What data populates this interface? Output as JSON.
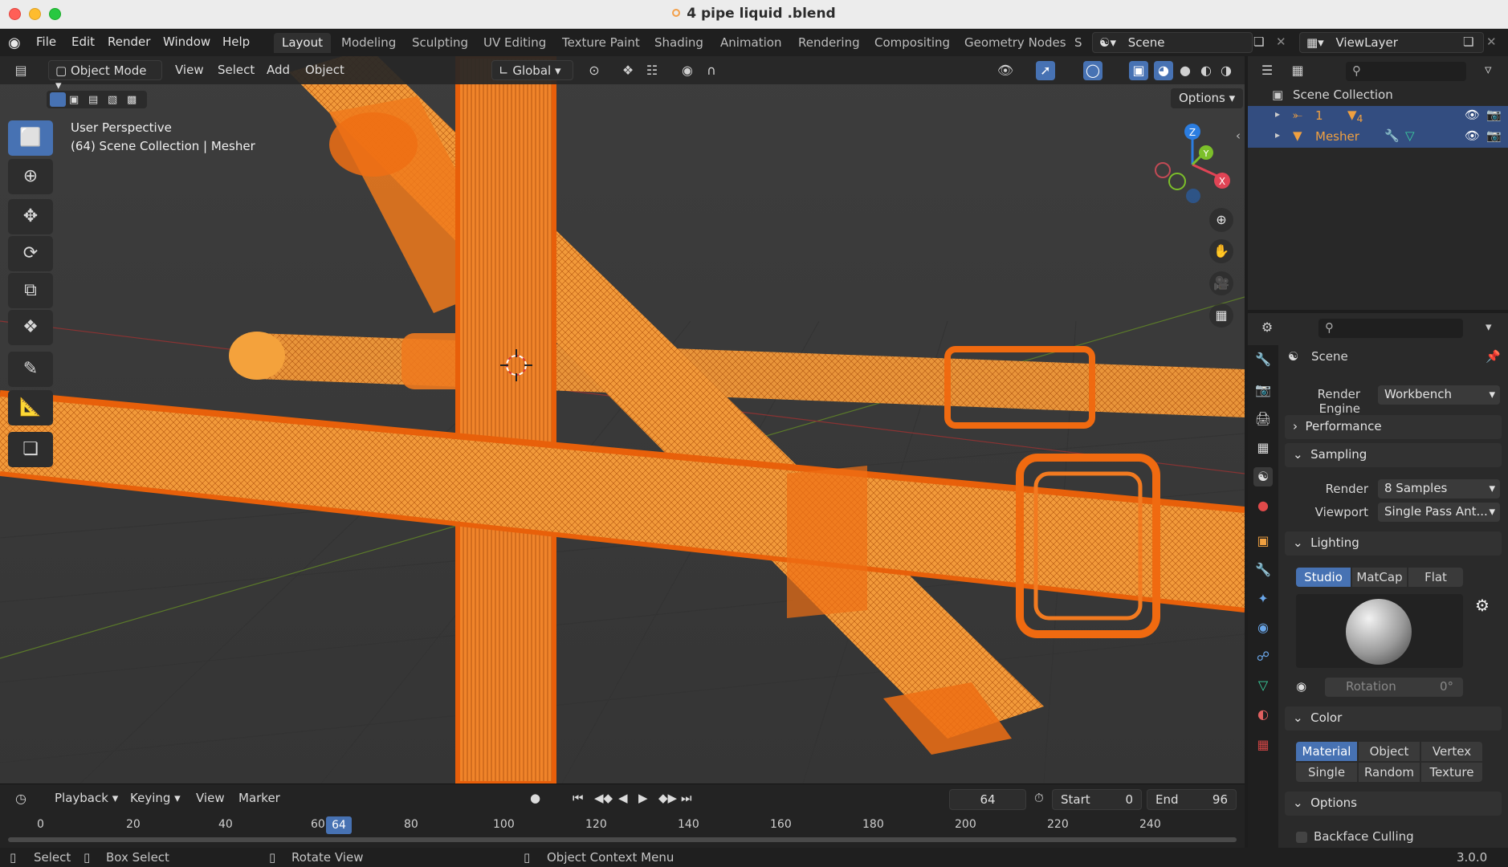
{
  "window": {
    "title": "4 pipe liquid .blend"
  },
  "menu": [
    "File",
    "Edit",
    "Render",
    "Window",
    "Help"
  ],
  "workspaces": [
    "Layout",
    "Modeling",
    "Sculpting",
    "UV Editing",
    "Texture Paint",
    "Shading",
    "Animation",
    "Rendering",
    "Compositing",
    "Geometry Nodes",
    "S"
  ],
  "active_workspace": "Layout",
  "scene_name": "Scene",
  "view_layer": "ViewLayer",
  "viewport": {
    "mode": "Object Mode",
    "menus": [
      "View",
      "Select",
      "Add",
      "Object"
    ],
    "orientation": "Global",
    "options_label": "Options",
    "info_line1": "User Perspective",
    "info_line2": "(64) Scene Collection | Mesher",
    "gizmo": {
      "x": "X",
      "y": "Y",
      "z": "Z"
    }
  },
  "outliner": {
    "root": "Scene Collection",
    "items": [
      {
        "name": "1",
        "badge": "4"
      },
      {
        "name": "Mesher"
      }
    ]
  },
  "properties": {
    "context": "Scene",
    "render_engine_label": "Render Engine",
    "render_engine": "Workbench",
    "performance": "Performance",
    "sampling": "Sampling",
    "render_label": "Render",
    "render_samples": "8 Samples",
    "viewport_label": "Viewport",
    "viewport_aa": "Single Pass Ant...",
    "lighting": "Lighting",
    "lighting_modes": [
      "Studio",
      "MatCap",
      "Flat"
    ],
    "rotation_label": "Rotation",
    "rotation_value": "0°",
    "color": "Color",
    "color_modes": [
      "Material",
      "Object",
      "Vertex",
      "Single",
      "Random",
      "Texture"
    ],
    "options": "Options",
    "backface": "Backface Culling"
  },
  "timeline": {
    "menus": [
      "Playback",
      "Keying",
      "View",
      "Marker"
    ],
    "current_frame": "64",
    "start_label": "Start",
    "start": "0",
    "end_label": "End",
    "end": "96",
    "ruler": [
      "0",
      "20",
      "40",
      "60",
      "80",
      "100",
      "120",
      "140",
      "160",
      "180",
      "200",
      "220",
      "240"
    ]
  },
  "statusbar": {
    "select": "Select",
    "box_select": "Box Select",
    "rotate_view": "Rotate View",
    "context_menu": "Object Context Menu",
    "version": "3.0.0"
  },
  "colors": {
    "accent": "#4772b3",
    "pipe": "#f07a1c",
    "pipe_light": "#f4a23c"
  }
}
